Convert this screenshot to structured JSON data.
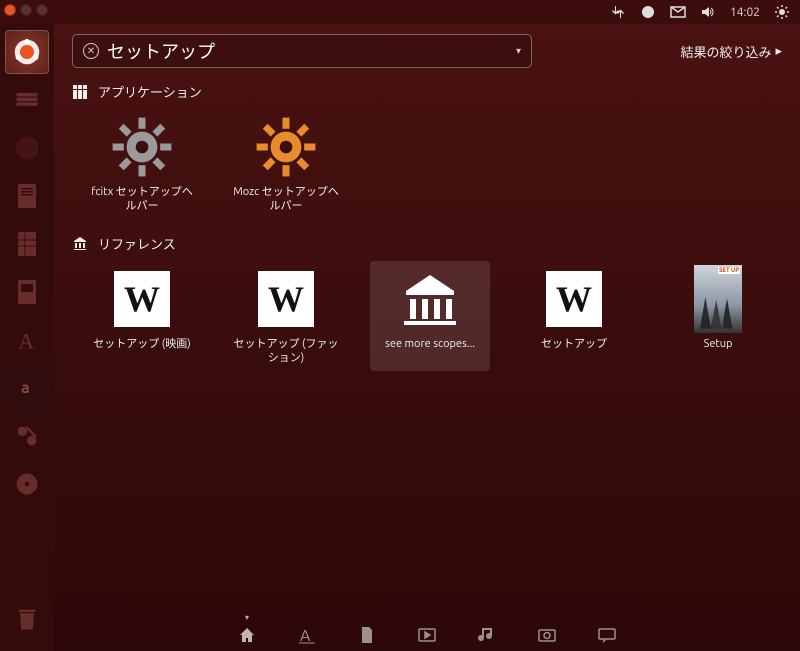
{
  "top": {
    "time": "14:02"
  },
  "search": {
    "value": "セットアップ"
  },
  "filter_label": "結果の絞り込み",
  "sections": {
    "apps": {
      "title": "アプリケーション",
      "items": [
        {
          "label": "fcitx セットアップヘルパー",
          "icon": "gear-gray"
        },
        {
          "label": "Mozc セットアップヘルパー",
          "icon": "gear-orange"
        }
      ]
    },
    "reference": {
      "title": "リファレンス",
      "items": [
        {
          "label": "セットアップ (映画)",
          "icon": "wikipedia"
        },
        {
          "label": "セットアップ (ファッション)",
          "icon": "wikipedia"
        },
        {
          "label": "see more scopes...",
          "icon": "bank",
          "selected": true
        },
        {
          "label": "セットアップ",
          "icon": "wikipedia"
        },
        {
          "label": "Setup",
          "icon": "movie"
        }
      ]
    }
  },
  "launcher": {
    "items": [
      "dash",
      "files",
      "firefox",
      "writer",
      "calc",
      "impress",
      "accessible",
      "amazon",
      "settings",
      "disc"
    ],
    "trash": "trash"
  },
  "lenses": [
    "home",
    "applications",
    "files",
    "video",
    "music",
    "photos",
    "messages"
  ]
}
